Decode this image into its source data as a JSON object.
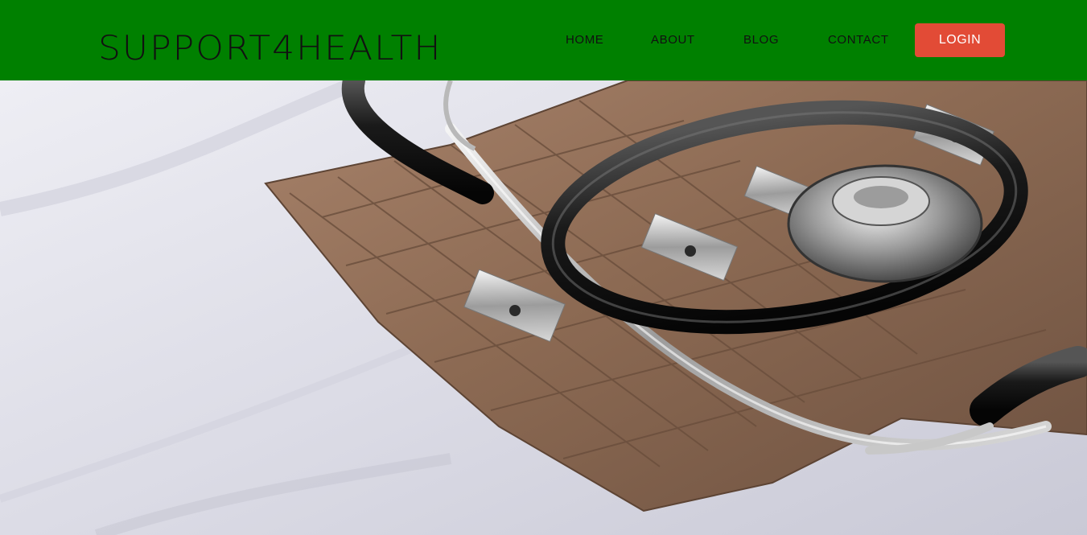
{
  "header": {
    "logo_text": "SUPPORT4HEALTH",
    "background_color": "#008000"
  },
  "nav": {
    "items": [
      {
        "label": "HOME"
      },
      {
        "label": "ABOUT"
      },
      {
        "label": "BLOG"
      },
      {
        "label": "CONTACT"
      }
    ],
    "login_label": "LOGIN",
    "login_color": "#e24b36"
  },
  "hero": {
    "image_subject": "stethoscope-on-blood-pressure-cuff"
  }
}
